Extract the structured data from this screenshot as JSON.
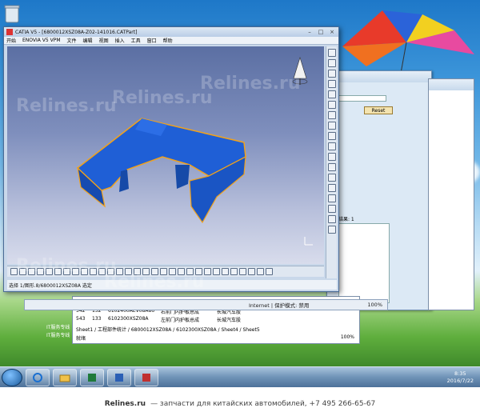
{
  "catia": {
    "title": "CATIA V5 - [6800012XSZ08A-Z02-141016.CATPart]",
    "menu": [
      "开始",
      "ENOVIA V5 VPM",
      "文件",
      "编辑",
      "视图",
      "插入",
      "工具",
      "窗口",
      "帮助"
    ],
    "status": "选择 1/图形.8/6800012XSZ08A 选定"
  },
  "background_windows": {
    "excel_rows": [
      {
        "no": "541",
        "col2": "130",
        "code": "6802010XEV08A88",
        "name": "左前门内饰总成",
        "maker": "长城汽车股"
      },
      {
        "no": "542",
        "col2": "132",
        "code": "6102400AEV08A86",
        "name": "右前门内护板总成",
        "maker": "长城汽车股"
      },
      {
        "no": "543",
        "col2": "133",
        "code": "6102300XSZ08A",
        "name": "左前门内护板总成",
        "maker": "长城汽车股"
      }
    ],
    "excel_tabs": "Sheet1 / 工程部件统计 / 6800012XSZ08A / 6102300XSZ08A / Sheet4 / Sheet5",
    "excel_status": "就绪",
    "excel_zoom": "100%",
    "ie_status": "Internet | 保护模式: 禁用",
    "ie_zoom": "100%",
    "catalog_label": "结果: 1",
    "catalog_tab": "Reset",
    "side_items": [
      "IT服务专线",
      "IT服务专线"
    ]
  },
  "taskbar": {
    "time": "8:35",
    "date": "2016/7/22"
  },
  "watermark": "Relines.ru",
  "footer": {
    "brand": "Relines.ru",
    "text": "— запчасти для китайских автомобилей, +7 495 266-65-67"
  },
  "colors": {
    "part": "#1f5fd6",
    "part_edge": "#f2a21a",
    "accent": "#4d719a"
  }
}
